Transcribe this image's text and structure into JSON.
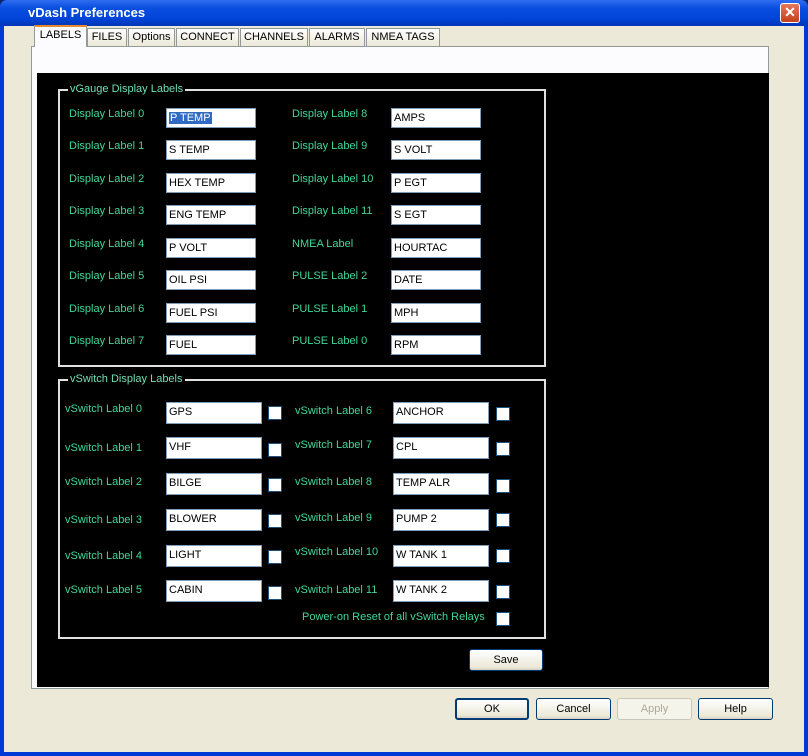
{
  "window": {
    "title": "vDash Preferences",
    "close_glyph": "✕"
  },
  "tabs": [
    "LABELS",
    "FILES",
    "Options",
    "CONNECT",
    "CHANNELS",
    "ALARMS",
    "NMEA TAGS"
  ],
  "vgauge": {
    "title": "vGauge Display Labels",
    "left": [
      {
        "label": "Display Label 0",
        "value": "P TEMP"
      },
      {
        "label": "Display Label 1",
        "value": "S TEMP"
      },
      {
        "label": "Display Label 2",
        "value": "HEX TEMP"
      },
      {
        "label": "Display Label 3",
        "value": "ENG TEMP"
      },
      {
        "label": "Display Label 4",
        "value": "P VOLT"
      },
      {
        "label": "Display Label 5",
        "value": "OIL PSI"
      },
      {
        "label": "Display Label 6",
        "value": "FUEL PSI"
      },
      {
        "label": "Display Label 7",
        "value": "FUEL"
      }
    ],
    "right": [
      {
        "label": "Display Label 8",
        "value": "AMPS"
      },
      {
        "label": "Display Label 9",
        "value": "S VOLT"
      },
      {
        "label": "Display Label 10",
        "value": "P EGT"
      },
      {
        "label": "Display Label 11",
        "value": "S EGT"
      },
      {
        "label": "NMEA Label",
        "value": "HOURTAC"
      },
      {
        "label": "PULSE Label 2",
        "value": "DATE"
      },
      {
        "label": "PULSE Label 1",
        "value": "MPH"
      },
      {
        "label": "PULSE Label 0",
        "value": "RPM"
      }
    ]
  },
  "vswitch": {
    "title": "vSwitch Display Labels",
    "left": [
      {
        "label": "vSwitch Label 0",
        "value": "GPS",
        "checked": false
      },
      {
        "label": "vSwitch Label 1",
        "value": "VHF",
        "checked": false
      },
      {
        "label": "vSwitch Label 2",
        "value": "BILGE",
        "checked": false
      },
      {
        "label": "vSwitch Label 3",
        "value": "BLOWER",
        "checked": false
      },
      {
        "label": "vSwitch Label 4",
        "value": "LIGHT",
        "checked": false
      },
      {
        "label": "vSwitch Label 5",
        "value": "CABIN",
        "checked": false
      }
    ],
    "right": [
      {
        "label": "vSwitch Label 6",
        "value": "ANCHOR",
        "checked": false
      },
      {
        "label": "vSwitch Label 7",
        "value": "CPL",
        "checked": false
      },
      {
        "label": "vSwitch Label 8",
        "value": "TEMP ALR",
        "checked": false
      },
      {
        "label": "vSwitch Label 9",
        "value": "PUMP 2",
        "checked": false
      },
      {
        "label": "vSwitch Label 10",
        "value": "W TANK 1",
        "checked": false
      },
      {
        "label": "vSwitch Label 11",
        "value": "W TANK 2",
        "checked": false
      }
    ],
    "power_reset_label": "Power-on Reset of all vSwitch Relays",
    "power_reset_checked": false
  },
  "buttons": {
    "save": "Save",
    "ok": "OK",
    "cancel": "Cancel",
    "apply": "Apply",
    "help": "Help"
  },
  "colors": {
    "label_green": "#43d69a",
    "panel_bg": "#000000",
    "title_bar": "#0045d8"
  }
}
